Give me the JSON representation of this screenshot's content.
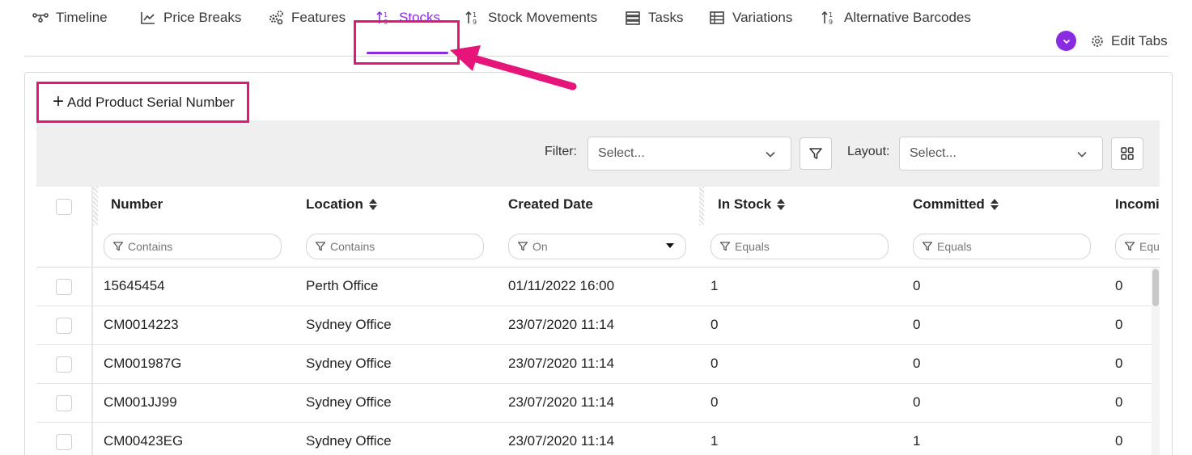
{
  "tabs": [
    {
      "label": "Timeline",
      "icon": "timeline-icon"
    },
    {
      "label": "Price Breaks",
      "icon": "chart-line-icon"
    },
    {
      "label": "Features",
      "icon": "gears-icon"
    },
    {
      "label": "Stocks",
      "icon": "sort-numeric-icon",
      "active": true
    },
    {
      "label": "Stock Movements",
      "icon": "sort-numeric-icon"
    },
    {
      "label": "Tasks",
      "icon": "server-icon"
    },
    {
      "label": "Variations",
      "icon": "table-icon"
    },
    {
      "label": "Alternative Barcodes",
      "icon": "sort-numeric-icon"
    }
  ],
  "edit_tabs_label": "Edit Tabs",
  "add_button_label": "Add Product Serial Number",
  "toolbar": {
    "filter_label": "Filter:",
    "filter_placeholder": "Select...",
    "layout_label": "Layout:",
    "layout_placeholder": "Select..."
  },
  "columns": [
    {
      "label": "Number",
      "filter": "Contains"
    },
    {
      "label": "Location",
      "filter": "Contains"
    },
    {
      "label": "Created Date",
      "filter": "On"
    },
    {
      "label": "In Stock",
      "filter": "Equals"
    },
    {
      "label": "Committed",
      "filter": "Equals"
    },
    {
      "label": "Incomi",
      "filter": "Equ"
    }
  ],
  "rows": [
    [
      "15645454",
      "Perth Office",
      "01/11/2022 16:00",
      "1",
      "0",
      "0"
    ],
    [
      "CM0014223",
      "Sydney Office",
      "23/07/2020 11:14",
      "0",
      "0",
      "0"
    ],
    [
      "CM001987G",
      "Sydney Office",
      "23/07/2020 11:14",
      "0",
      "0",
      "0"
    ],
    [
      "CM001JJ99",
      "Sydney Office",
      "23/07/2020 11:14",
      "0",
      "0",
      "0"
    ],
    [
      "CM00423EG",
      "Sydney Office",
      "23/07/2020 11:14",
      "1",
      "1",
      "0"
    ]
  ],
  "colors": {
    "accent": "#8a2be2",
    "highlight": "#e6157a"
  }
}
